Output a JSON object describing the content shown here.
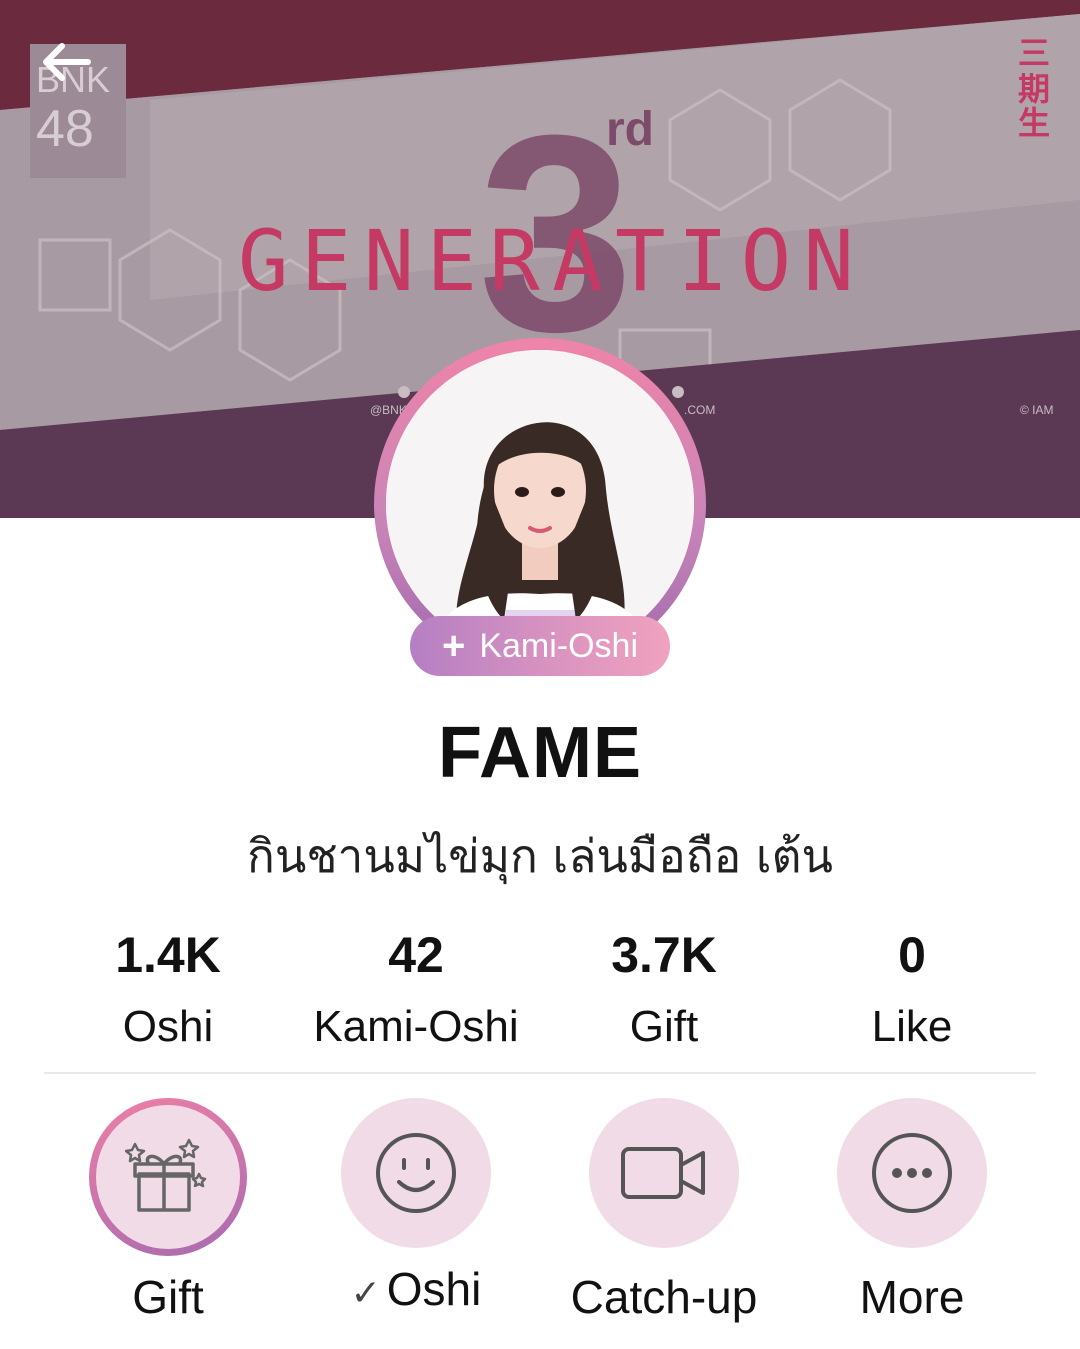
{
  "banner": {
    "logo_text_line1": "BNK",
    "logo_text_line2": "48",
    "title_generation": "GENERATION",
    "title_3": "3",
    "title_rd": "rd",
    "side_kanji": "三期生",
    "footer_left": "@BNK",
    "footer_mid": ".COM",
    "footer_right": "© IAM",
    "colors": {
      "top_band": "#6b2a3e",
      "bottom_band": "#5b3954",
      "panel": "#c9bcc2",
      "accent": "#c43a64"
    }
  },
  "profile": {
    "kami_button": {
      "icon": "+",
      "label": "Kami-Oshi"
    },
    "name": "FAME",
    "bio": "กินชานมไข่มุก เล่นมือถือ เต้น"
  },
  "stats": [
    {
      "value": "1.4K",
      "label": "Oshi"
    },
    {
      "value": "42",
      "label": "Kami-Oshi"
    },
    {
      "value": "3.7K",
      "label": "Gift"
    },
    {
      "value": "0",
      "label": "Like"
    }
  ],
  "actions": [
    {
      "label": "Gift",
      "icon": "gift-icon",
      "active": true
    },
    {
      "label": "Oshi",
      "icon": "smiley-icon",
      "checked": true,
      "check_glyph": "✓"
    },
    {
      "label": "Catch-up",
      "icon": "video-camera-icon"
    },
    {
      "label": "More",
      "icon": "more-dots-icon"
    }
  ],
  "theme": {
    "gradient_start": "#ef84a8",
    "gradient_end": "#9f67ad",
    "action_bg": "#f0dbe6"
  }
}
